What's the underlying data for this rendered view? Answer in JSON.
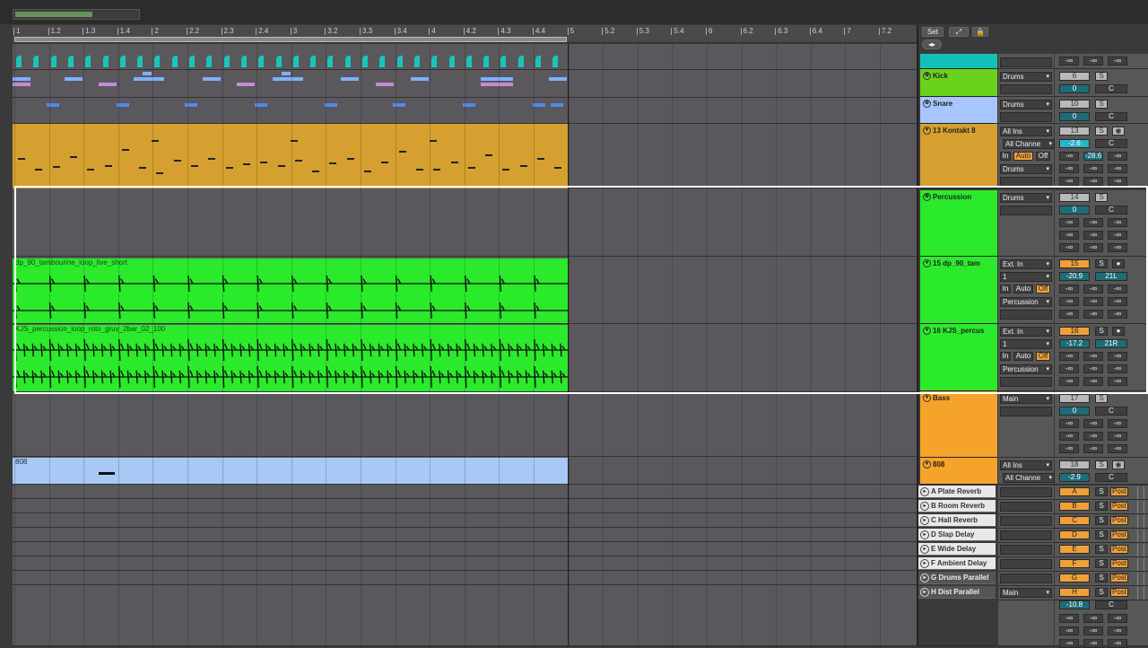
{
  "ruler": {
    "ticks": [
      "1",
      "1.2",
      "1.3",
      "1.4",
      "2",
      "2.2",
      "2.3",
      "2.4",
      "3",
      "3.2",
      "3.3",
      "3.4",
      "4",
      "4.2",
      "4.3",
      "4.4",
      "5",
      "5.2",
      "5.3",
      "5.4",
      "6",
      "6.2",
      "6.3",
      "6.4",
      "7",
      "7.2"
    ]
  },
  "header": {
    "set_label": "Set"
  },
  "clips": {
    "tambourine": "dp_90_tambourine_loop_live_short",
    "percussion": "KJS_percussion_loop_roto_gruv_2bar_02_100",
    "b808": "808"
  },
  "tracks": {
    "top": {
      "name": "",
      "color": "#13c0b8"
    },
    "kick": {
      "name": "Kick",
      "color": "#6ad11c",
      "route": "Drums",
      "num": "6",
      "vol": "0",
      "pan": "C",
      "solo": "S"
    },
    "snare": {
      "name": "Snare",
      "color": "#a8c5ff",
      "route": "Drums",
      "num": "10",
      "vol": "0",
      "pan": "C",
      "solo": "S"
    },
    "kontakt": {
      "name": "13 Kontakt 8",
      "color": "#d6a030",
      "in": "All Ins",
      "ch": "All Channe",
      "mon_in": "In",
      "mon_auto": "Auto",
      "mon_off": "Off",
      "out": "Drums",
      "num": "13",
      "vol": "-2.6",
      "pan": "C",
      "sends": [
        "-∞",
        "-28.6",
        "-∞"
      ],
      "solo": "S"
    },
    "percussion": {
      "name": "Percussion",
      "color": "#2bea2b",
      "route": "Drums",
      "num": "14",
      "vol": "0",
      "pan": "C",
      "solo": "S"
    },
    "tam": {
      "name": "15 dp_90_tam",
      "color": "#2bea2b",
      "in": "Ext. In",
      "ch": "1",
      "mon_in": "In",
      "mon_auto": "Auto",
      "mon_off": "Off",
      "out": "Percussion",
      "num": "15",
      "vol": "-20.9",
      "pan": "21L",
      "solo": "S"
    },
    "kjs": {
      "name": "16 KJS_percus",
      "color": "#2bea2b",
      "in": "Ext. In",
      "ch": "1",
      "mon_in": "In",
      "mon_auto": "Auto",
      "mon_off": "Off",
      "out": "Percussion",
      "num": "16",
      "vol": "-17.2",
      "pan": "21R",
      "solo": "S"
    },
    "bass": {
      "name": "Bass",
      "color": "#f5a32a",
      "route": "Main",
      "num": "17",
      "vol": "0",
      "pan": "C",
      "solo": "S"
    },
    "b808": {
      "name": "808",
      "color": "#f5a32a",
      "in": "All Ins",
      "ch": "All Channe",
      "num": "18",
      "vol": "-2.9",
      "pan": "C",
      "solo": "S"
    }
  },
  "minus_inf": "-∞",
  "returns": [
    {
      "name": "A Plate Reverb",
      "letter": "A",
      "solo": "S",
      "post": "Post"
    },
    {
      "name": "B Room Reverb",
      "letter": "B",
      "solo": "S",
      "post": "Post"
    },
    {
      "name": "C Hall Reverb",
      "letter": "C",
      "solo": "S",
      "post": "Post"
    },
    {
      "name": "D Slap Delay",
      "letter": "D",
      "solo": "S",
      "post": "Post"
    },
    {
      "name": "E Wide Delay",
      "letter": "E",
      "solo": "S",
      "post": "Post"
    },
    {
      "name": "F Ambient Delay",
      "letter": "F",
      "solo": "S",
      "post": "Post"
    },
    {
      "name": "G Drums Parallel",
      "letter": "G",
      "solo": "S",
      "post": "Post"
    },
    {
      "name": "H Dist Parallel",
      "letter": "H",
      "solo": "S",
      "post": "Post",
      "route": "Main",
      "vol": "-10.8",
      "pan": "C"
    }
  ]
}
